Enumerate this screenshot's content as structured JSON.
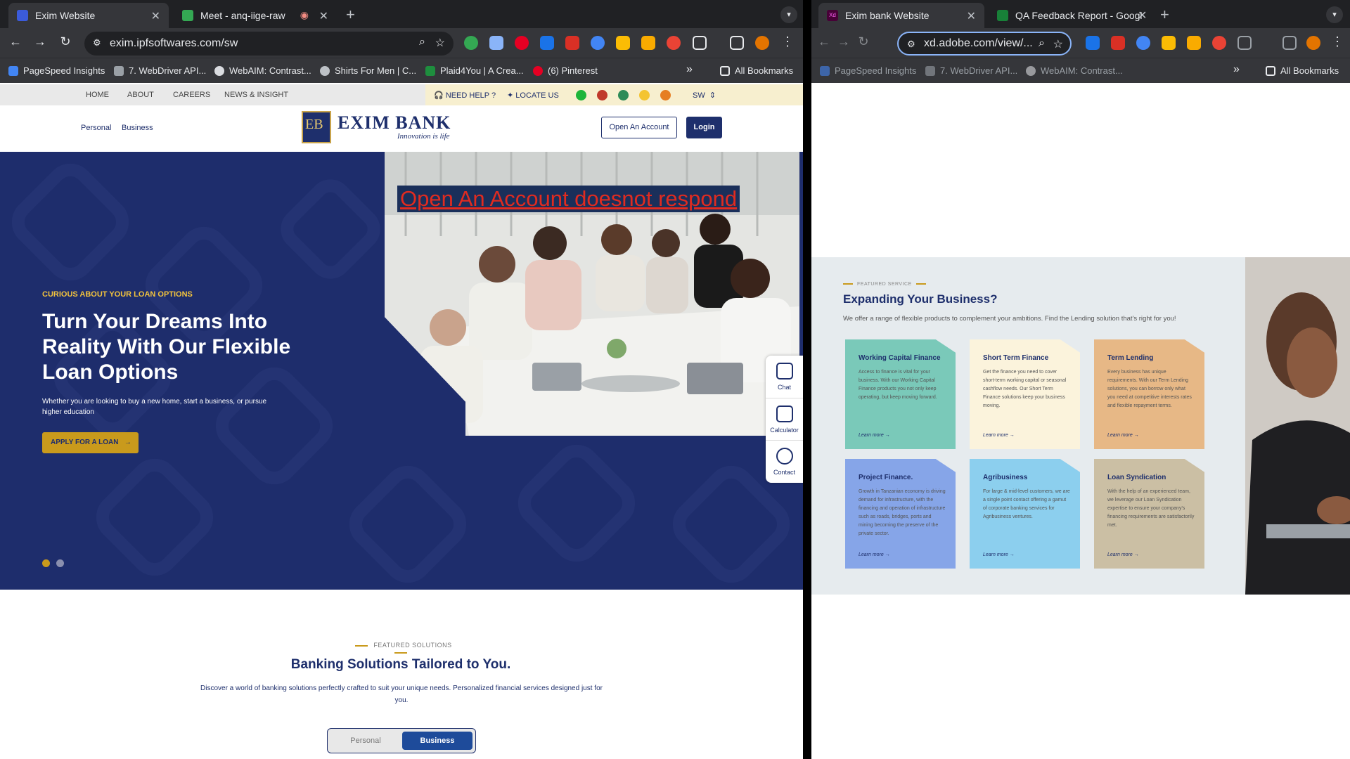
{
  "left_browser": {
    "tabs": [
      {
        "title": "Exim Website",
        "active": true
      },
      {
        "title": "Meet - anq-iige-raw",
        "active": false
      }
    ],
    "url": "exim.ipfsoftwares.com/sw",
    "bookmarks": [
      "PageSpeed Insights",
      "7. WebDriver API...",
      "WebAIM: Contrast...",
      "Shirts For Men | C...",
      "Plaid4You | A Crea...",
      "(6) Pinterest"
    ],
    "all_bookmarks": "All Bookmarks",
    "more_bookmarks": "»"
  },
  "right_browser": {
    "tabs": [
      {
        "title": "Exim bank Website",
        "active": true
      },
      {
        "title": "QA Feedback Report - Googl",
        "active": false
      }
    ],
    "url": "xd.adobe.com/view/...",
    "bookmarks": [
      "PageSpeed Insights",
      "7. WebDriver API...",
      "WebAIM: Contrast..."
    ],
    "all_bookmarks": "All Bookmarks",
    "more_bookmarks": "»",
    "xd_badge": "Xd"
  },
  "site": {
    "topnav": {
      "links": [
        "HOME",
        "ABOUT",
        "CAREERS",
        "NEWS & INSIGHT"
      ],
      "need_help": "NEED HELP ?",
      "locate_us": "LOCATE US",
      "language": "SW",
      "flag_colors": [
        "#1eb53a",
        "#c0392b",
        "#f4c430",
        "#e67e22",
        "#2e8b57"
      ]
    },
    "header": {
      "links": [
        "Personal",
        "Business"
      ],
      "logo_mark": "EB",
      "logo_name": "EXIM BANK",
      "logo_tagline": "Innovation is life",
      "open_account": "Open An Account",
      "login": "Login"
    },
    "hero": {
      "eyebrow": "CURIOUS ABOUT YOUR LOAN OPTIONS",
      "title": "Turn Your Dreams Into Reality With Our Flexible Loan Options",
      "subtitle": "Whether you are looking to buy a new home, start a business, or pursue higher education",
      "cta": "APPLY FOR A LOAN",
      "cta_arrow": "→",
      "slide_count": 2,
      "active_slide": 1,
      "qa_note": "Open An Account doesnot respond"
    },
    "side_widget": [
      "Chat",
      "Calculator",
      "Contact"
    ],
    "featured": {
      "eyebrow": "FEATURED SOLUTIONS",
      "title": "Banking Solutions Tailored to You.",
      "description": "Discover a world of banking solutions perfectly crafted to suit your unique needs. Personalized financial services designed just for you.",
      "toggle": [
        "Personal",
        "Business"
      ],
      "toggle_active": "Business"
    }
  },
  "xd": {
    "eyebrow": "FEATURED SERVICE",
    "title": "Expanding Your Business?",
    "lead": "We offer a range of flexible products to complement your ambitions. Find the Lending solution that's right for you!",
    "cards": [
      {
        "title": "Working Capital Finance",
        "body": "Access to finance is vital for your business. With our Working Capital Finance products you not only keep operating, but keep moving forward.",
        "link": "Learn more →",
        "color": "#7ac9b9"
      },
      {
        "title": "Short Term Finance",
        "body": "Get the finance you need to cover short-term working capital or seasonal cashflow needs. Our Short Term Finance solutions keep your business moving.",
        "link": "Learn more →",
        "color": "#fbf3dc"
      },
      {
        "title": "Term Lending",
        "body": "Every business has unique requirements. With our Term Lending solutions, you can borrow only what you need at competitive interests rates and flexible repayment terms.",
        "link": "Learn more →",
        "color": "#e7b886"
      },
      {
        "title": "Project Finance.",
        "body": "Growth in Tanzanian economy is driving demand for infrastructure, with the financing and operation of infrastructure such as roads, bridges, ports and mining becoming the preserve of the private sector.",
        "link": "Learn more →",
        "color": "#86a5e8"
      },
      {
        "title": "Agribusiness",
        "body": "For large & mid-level customers, we are a single point contact offering a gamut of corporate banking services for Agribusiness ventures.",
        "link": "Learn more →",
        "color": "#8ccfee"
      },
      {
        "title": "Loan Syndication",
        "body": "With the help of an experienced team, we leverage our Loan Syndication expertise to ensure your company's financing requirements are satisfactorily met.",
        "link": "Learn more →",
        "color": "#cbbfa4"
      }
    ]
  }
}
